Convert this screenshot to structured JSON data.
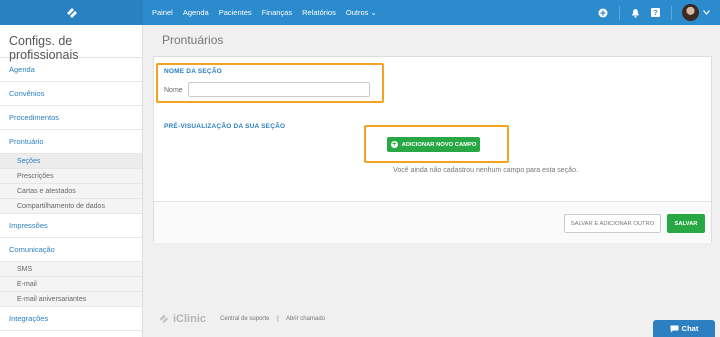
{
  "topbar": {
    "logo_icon": "iclinic-logo-icon",
    "nav": [
      "Painel",
      "Agenda",
      "Pacientes",
      "Finanças",
      "Relatórios",
      "Outros ⌄"
    ],
    "right_icons": [
      "plus-circle-icon",
      "bell-icon",
      "help-icon"
    ]
  },
  "sidebar": {
    "title": "Configs. de profissionais",
    "items": [
      {
        "label": "Agenda"
      },
      {
        "label": "Convênios"
      },
      {
        "label": "Procedimentos"
      },
      {
        "label": "Prontuário"
      }
    ],
    "prontuario_sub": [
      "Seções",
      "Prescrições",
      "Cartas e atestados",
      "Compartilhamento de dados"
    ],
    "impressoes": "Impressões",
    "comunicacao": "Comunicação",
    "comunicacao_sub": [
      "SMS",
      "E-mail",
      "E-mail aniversariantes"
    ],
    "integracoes": "Integrações"
  },
  "main": {
    "page_title": "Prontuários",
    "section_name_label": "NOME DA SEÇÃO",
    "name_field_label": "Nome",
    "name_field_value": "",
    "preview_label": "PRÉ-VISUALIZAÇÃO DA SUA SEÇÃO",
    "add_field_button": "ADICIONAR NOVO CAMPO",
    "empty_message": "Você ainda não cadastrou nenhum campo para esta seção.",
    "save_add_button": "SALVAR E ADICIONAR OUTRO",
    "save_button": "SALVAR"
  },
  "footer": {
    "brand": "iClinic",
    "support": "Central de suporte",
    "separator": "|",
    "open_ticket": "Abrir chamado"
  },
  "chat": {
    "label": "Chat"
  },
  "colors": {
    "primary": "#2c8bcc",
    "accent_link": "#2c7fc1",
    "success": "#28a745",
    "highlight": "#f4a224"
  }
}
